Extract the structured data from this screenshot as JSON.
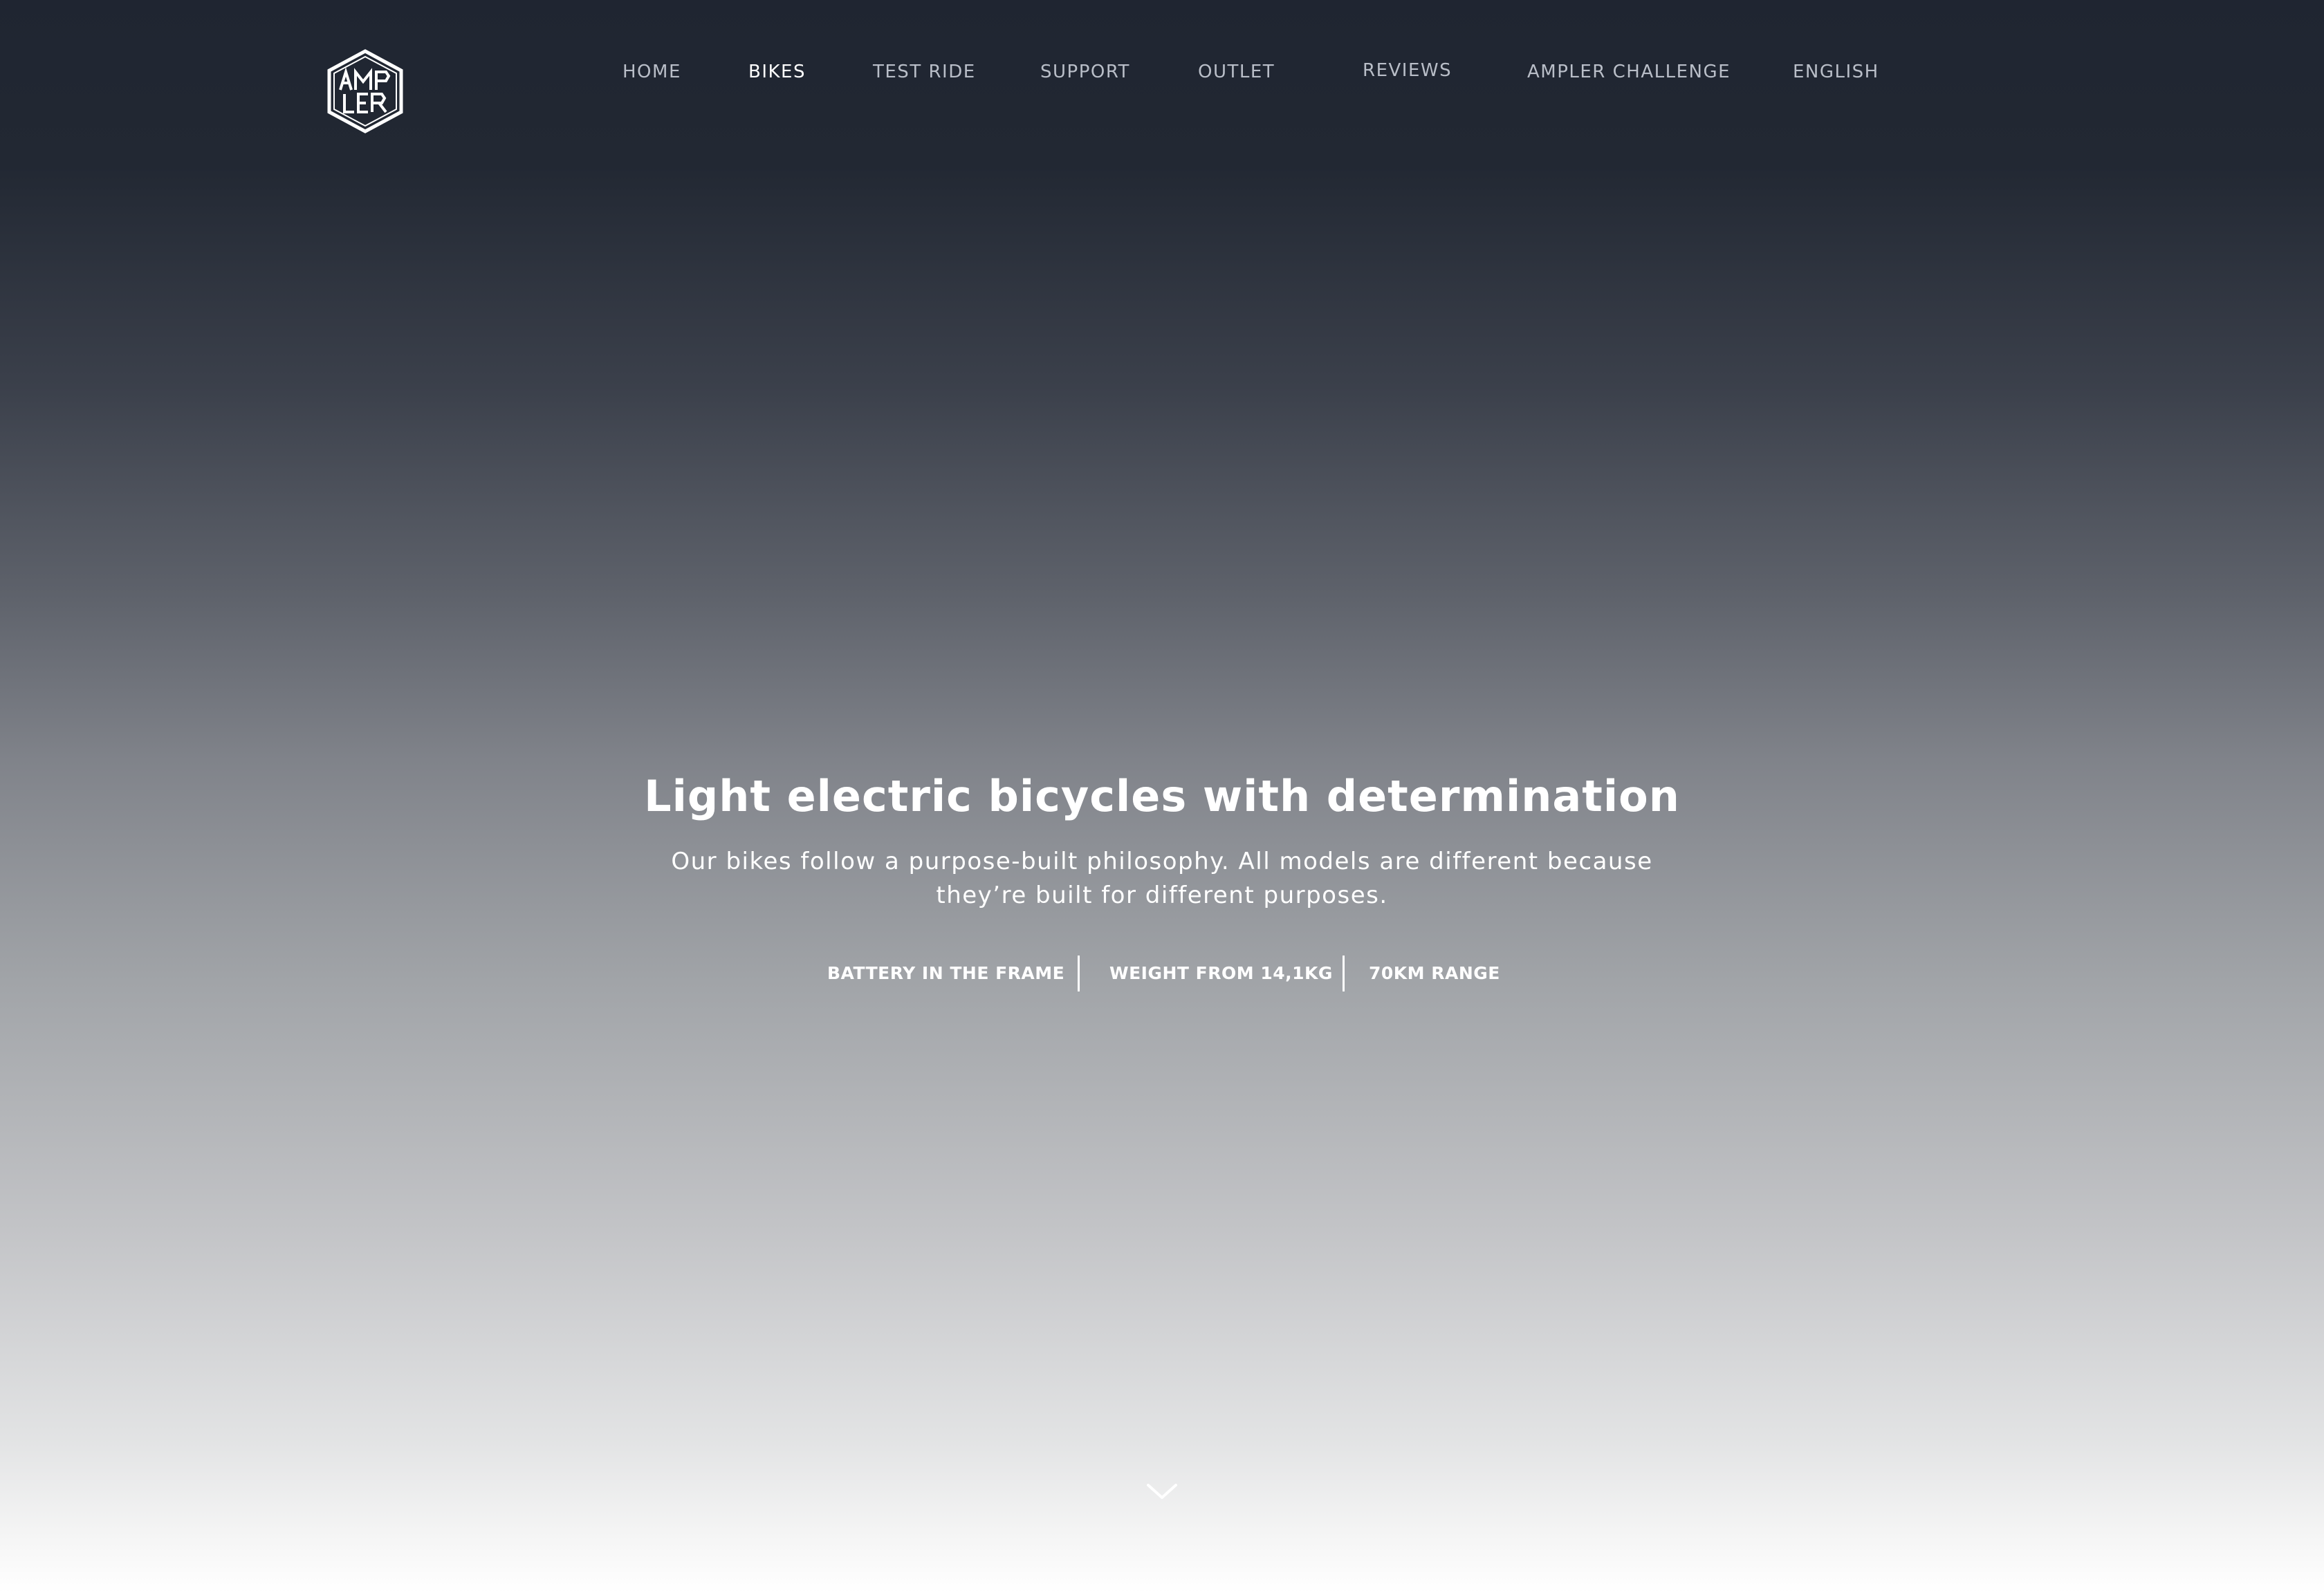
{
  "brand": {
    "logo_icon": "ampler-hexagon-logo-icon",
    "logo_text": "AMPLER"
  },
  "nav": {
    "items": [
      {
        "label": "HOME",
        "active": false
      },
      {
        "label": "BIKES",
        "active": true
      },
      {
        "label": "TEST RIDE",
        "active": false
      },
      {
        "label": "SUPPORT",
        "active": false
      },
      {
        "label": "OUTLET",
        "active": false
      },
      {
        "label": "REVIEWS",
        "active": false
      },
      {
        "label": "AMPLER CHALLENGE",
        "active": false
      },
      {
        "label": "ENGLISH",
        "active": false
      }
    ]
  },
  "hero": {
    "title": "Light electric bicycles with determination",
    "subtitle_line1": "Our bikes follow a purpose-built philosophy. All models are different because",
    "subtitle_line2": "they’re built for different purposes.",
    "features": [
      "BATTERY IN THE FRAME",
      "WEIGHT FROM 14,1KG",
      "70KM RANGE"
    ]
  },
  "scroll_hint": {
    "icon": "chevron-down-icon"
  },
  "colors": {
    "nav_text": "#b9bec8",
    "nav_active": "#ffffff",
    "top_background": "#1f2531",
    "bottom_background": "#ffffff"
  }
}
